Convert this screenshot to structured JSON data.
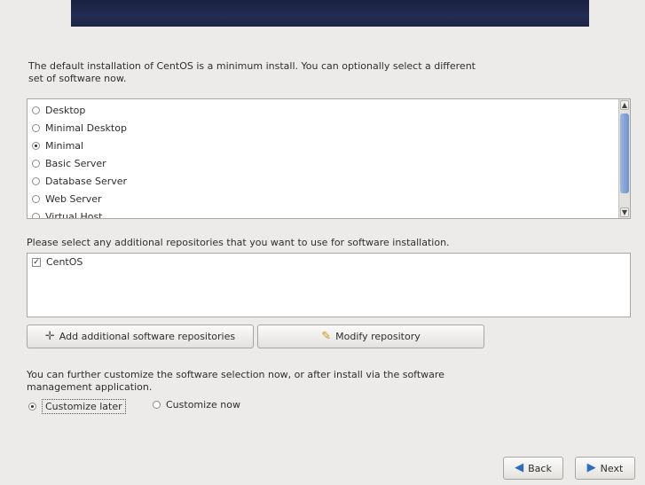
{
  "intro_text": "The default installation of CentOS is a minimum install. You can optionally select a different set of software now.",
  "install_options": [
    {
      "label": "Desktop",
      "selected": false
    },
    {
      "label": "Minimal Desktop",
      "selected": false
    },
    {
      "label": "Minimal",
      "selected": true
    },
    {
      "label": "Basic Server",
      "selected": false
    },
    {
      "label": "Database Server",
      "selected": false
    },
    {
      "label": "Web Server",
      "selected": false
    },
    {
      "label": "Virtual Host",
      "selected": false
    }
  ],
  "repo_prompt": "Please select any additional repositories that you want to use for software installation.",
  "repositories": [
    {
      "label": "CentOS",
      "checked": true
    }
  ],
  "buttons": {
    "add_repo": "Add additional software repositories",
    "modify_repo": "Modify repository",
    "back": "Back",
    "next": "Next"
  },
  "customize_text": "You can further customize the software selection now, or after install via the software management application.",
  "customize_options": {
    "later": "Customize later",
    "now": "Customize now"
  },
  "colors": {
    "banner": "#1c2445",
    "arrow_blue": "#2f6bbf"
  }
}
